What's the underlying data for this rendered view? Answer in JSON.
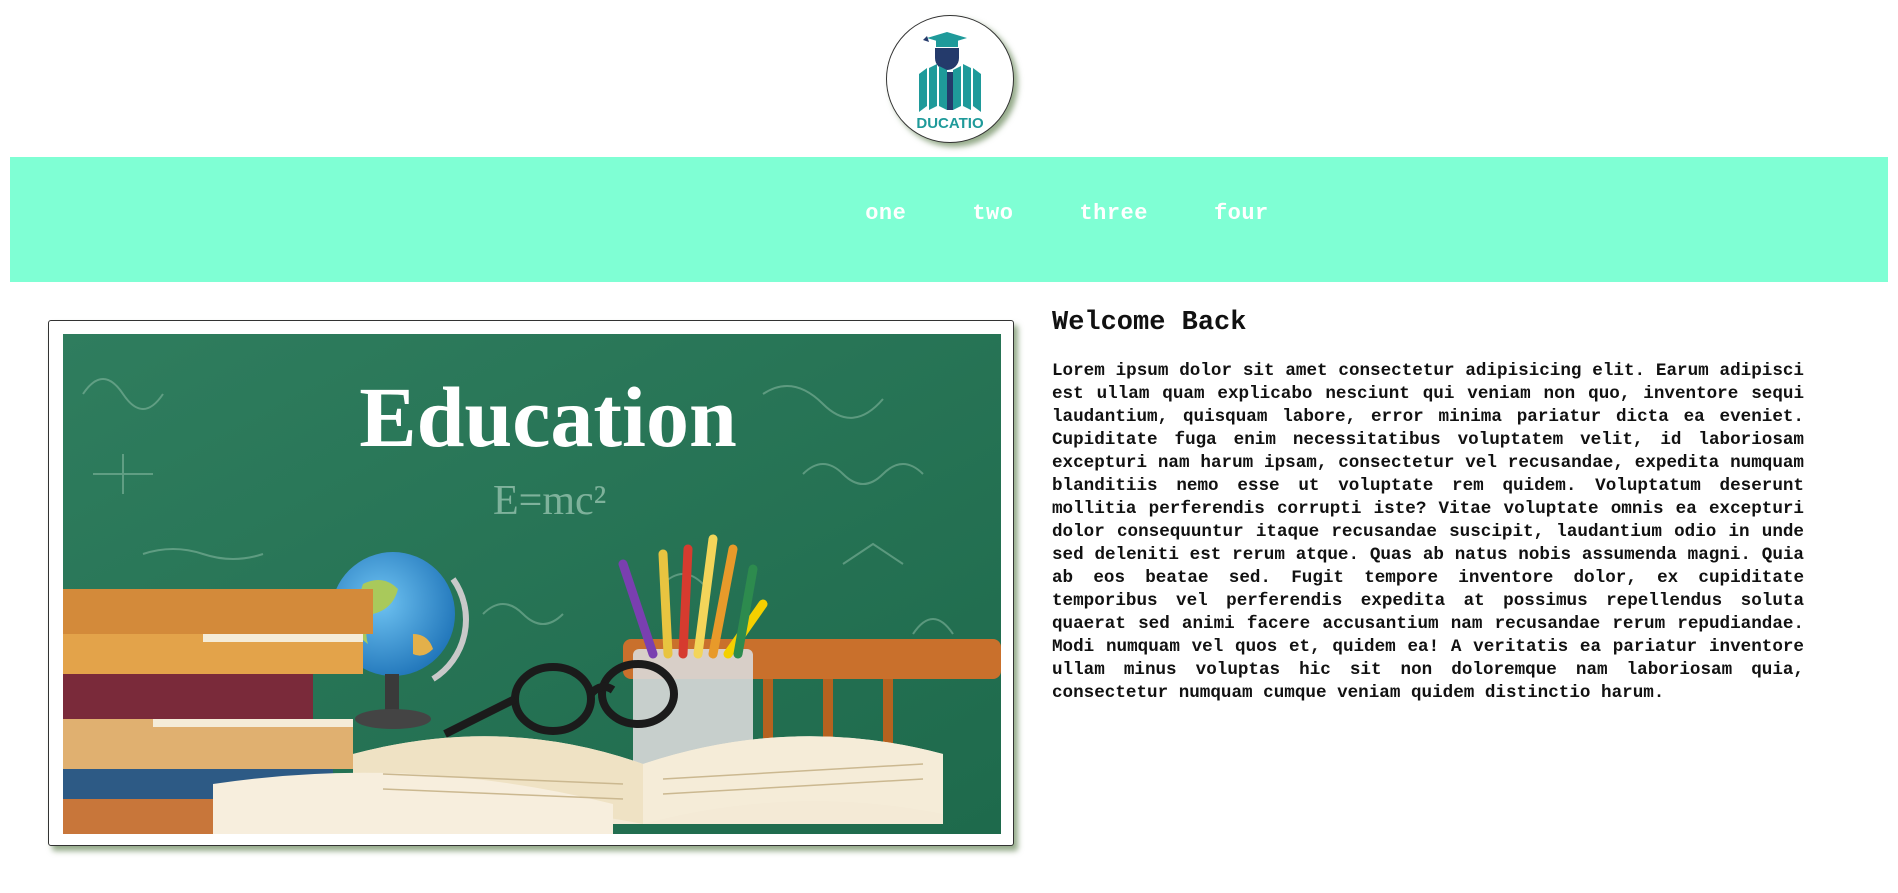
{
  "logo": {
    "text": "DUCATIO",
    "icon": "graduation-book-logo",
    "colors": {
      "teal": "#1f9a9a",
      "navy": "#243a6b"
    }
  },
  "nav": {
    "background": "#7fffd4",
    "items": [
      {
        "label": "one"
      },
      {
        "label": "two"
      },
      {
        "label": "three"
      },
      {
        "label": "four"
      }
    ]
  },
  "hero_image": {
    "title_text": "Education",
    "formula_text": "E=mc²"
  },
  "content": {
    "heading": "Welcome Back",
    "paragraph": "Lorem ipsum dolor sit amet consectetur adipisicing elit. Earum adipisci est ullam quam explicabo nesciunt qui veniam non quo, inventore sequi laudantium, quisquam labore, error minima pariatur dicta ea eveniet. Cupiditate fuga enim necessitatibus voluptatem velit, id laboriosam excepturi nam harum ipsam, consectetur vel recusandae, expedita numquam blanditiis nemo esse ut voluptate rem quidem. Voluptatum deserunt mollitia perferendis corrupti iste? Vitae voluptate omnis ea excepturi dolor consequuntur itaque recusandae suscipit, laudantium odio in unde sed deleniti est rerum atque. Quas ab natus nobis assumenda magni. Quia ab eos beatae sed. Fugit tempore inventore dolor, ex cupiditate temporibus vel perferendis expedita at possimus repellendus soluta quaerat sed animi facere accusantium nam recusandae rerum repudiandae. Modi numquam vel quos et, quidem ea! A veritatis ea pariatur inventore ullam minus voluptas hic sit non doloremque nam laboriosam quia, consectetur numquam cumque veniam quidem distinctio harum."
  }
}
